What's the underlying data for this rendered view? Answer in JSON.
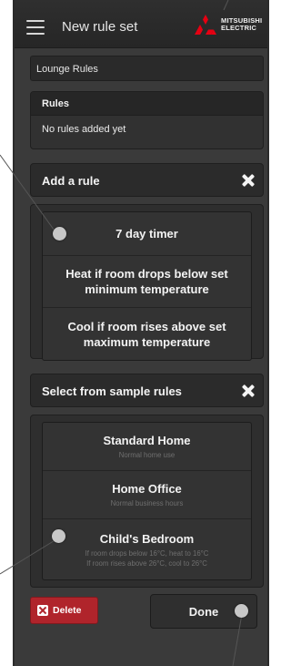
{
  "header": {
    "title": "New rule set",
    "menu_icon": "hamburger-menu-icon",
    "brand_line1": "MITSUBISHI",
    "brand_line2": "ELECTRIC",
    "brand_color": "#e60012"
  },
  "ruleset_name": {
    "value": "Lounge Rules"
  },
  "rules_panel": {
    "title": "Rules",
    "empty_text": "No rules added yet"
  },
  "add_rule": {
    "title": "Add a rule",
    "options": [
      {
        "label": "7 day timer"
      },
      {
        "label": "Heat if room drops below set minimum temperature"
      },
      {
        "label": "Cool if room rises above set maximum temperature"
      }
    ]
  },
  "sample_rules": {
    "title": "Select from sample rules",
    "options": [
      {
        "label": "Standard Home",
        "sub1": "Normal home use",
        "sub2": ""
      },
      {
        "label": "Home Office",
        "sub1": "Normal business hours",
        "sub2": ""
      },
      {
        "label": "Child's Bedroom",
        "sub1": "If room drops below 16°C, heat to 16°C",
        "sub2": "If room rises above 26°C, cool to 26°C"
      }
    ]
  },
  "actions": {
    "delete_label": "Delete",
    "done_label": "Done"
  },
  "colors": {
    "delete": "#b0242b",
    "background": "#3a3a3a"
  }
}
